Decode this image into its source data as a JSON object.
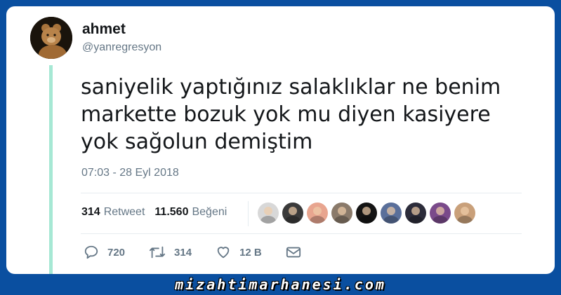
{
  "author": {
    "name": "ahmet",
    "handle": "@yanregresyon"
  },
  "tweet": {
    "lines": [
      "saniyelik yaptığınız salaklıklar ne benim",
      "markette bozuk yok mu diyen kasiyere",
      "yok sağolun demiştim"
    ],
    "timestamp": "07:03 - 28 Eyl 2018"
  },
  "stats": {
    "retweet_count": "314",
    "retweet_label": "Retweet",
    "like_count": "11.560",
    "like_label": "Beğeni"
  },
  "likers": [
    {
      "color": "#d8d8d8"
    },
    {
      "color": "#3a3a3a"
    },
    {
      "color": "#e8a58f"
    },
    {
      "color": "#8a7a6a"
    },
    {
      "color": "#141414"
    },
    {
      "color": "#5a6f9a"
    },
    {
      "color": "#2c2c3a"
    },
    {
      "color": "#7a4a8a"
    },
    {
      "color": "#c9a07a"
    }
  ],
  "actions": {
    "reply_count": "720",
    "retweet_count": "314",
    "like_count": "12 B"
  },
  "watermark": "mizahtimarhanesi.com",
  "colors": {
    "background": "#0a4fa0",
    "thread_line": "#a6e8d4",
    "text": "#14171a",
    "muted": "#657786"
  }
}
